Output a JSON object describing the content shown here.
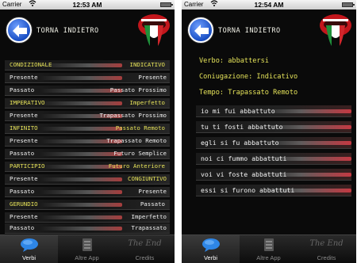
{
  "left": {
    "status": {
      "carrier": "Carrier",
      "time": "12:53 AM"
    },
    "header": {
      "back_label": "TORNA INDIETRO"
    },
    "rows": [
      {
        "label": "CONDIZIONALE",
        "value": "INDICATIVO",
        "highlight": true
      },
      {
        "label": "Presente",
        "value": "Presente",
        "highlight": false
      },
      {
        "label": "Passato",
        "value": "Passato Prossimo",
        "highlight": false
      },
      {
        "label": "IMPERATIVO",
        "value": "Imperfetto",
        "highlight": true
      },
      {
        "label": "Presente",
        "value": "Trapassato Prossimo",
        "highlight": false
      },
      {
        "label": "INFINITO",
        "value": "Passato Remoto",
        "highlight": true
      },
      {
        "label": "Presente",
        "value": "Trapassato Remoto",
        "highlight": false
      },
      {
        "label": "Passato",
        "value": "Futuro Semplice",
        "highlight": false
      },
      {
        "label": "PARTICIPIO",
        "value": "Futuro Anteriore",
        "highlight": true
      },
      {
        "label": "Presente",
        "value": "CONGIUNTIVO",
        "highlight": false
      },
      {
        "label": "Passato",
        "value": "Presente",
        "highlight": false
      },
      {
        "label": "GERUNDIO",
        "value": "Passato",
        "highlight": true
      },
      {
        "label": "Presente",
        "value": "Imperfetto",
        "highlight": false
      },
      {
        "label": "Passato",
        "value": "Trapassato",
        "highlight": false
      }
    ],
    "tabs": [
      {
        "label": "Verbi",
        "icon": "speech-bubble-icon",
        "active": true
      },
      {
        "label": "Altre App",
        "icon": "app-stack-icon",
        "active": false
      },
      {
        "label": "Credits",
        "icon": "the-end-icon",
        "icon_text": "The End",
        "active": false
      }
    ]
  },
  "right": {
    "status": {
      "carrier": "Carrier",
      "time": "12:54 AM"
    },
    "header": {
      "back_label": "TORNA INDIETRO"
    },
    "verb": "Verbo: abbattersi",
    "conjugation": "Coniugazione: Indicativo",
    "tense": "Tempo: Trapassato Remoto",
    "conjugations": [
      "io mi fui abbattuto",
      "tu ti fosti abbattuto",
      "egli si fu abbattuto",
      "noi ci fummo abbattuti",
      "voi vi foste abbattuti",
      "essi si furono abbattuti"
    ],
    "tabs": [
      {
        "label": "Verbi",
        "icon": "speech-bubble-icon",
        "active": true
      },
      {
        "label": "Altre App",
        "icon": "app-stack-icon",
        "active": false
      },
      {
        "label": "Credits",
        "icon": "the-end-icon",
        "icon_text": "The End",
        "active": false
      }
    ]
  },
  "colors": {
    "accent_yellow": "#e8e45a",
    "background": "#0a0a0a",
    "back_button_blue": "#1a4fc4",
    "flag_green": "#1f8f3a",
    "flag_red": "#d1262b"
  }
}
